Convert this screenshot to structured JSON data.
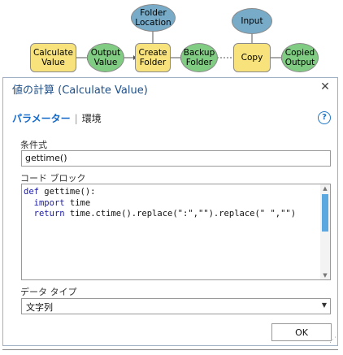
{
  "model": {
    "nodes": {
      "calculate_value": "Calculate\nValue",
      "output_value": "Output\nValue",
      "create_folder": "Create\nFolder",
      "backup_folder": "Backup\nFolder",
      "copy": "Copy",
      "copied_output": "Copied\nOutput",
      "folder_location": "Folder\nLocation",
      "input": "Input"
    },
    "colors": {
      "tool": "#f8e27c",
      "derived_data": "#80cc82",
      "input_data": "#77abc8"
    }
  },
  "dialog": {
    "title": "値の計算 (Calculate Value)",
    "close_icon": "close-icon",
    "tabs": {
      "parameters": "パラメーター",
      "separator": "|",
      "environments": "環境"
    },
    "help_glyph": "?",
    "expression_label": "条件式",
    "expression_value": "gettime()",
    "code_block_label": "コード ブロック",
    "code_block": {
      "line1_kw": "def",
      "line1_rest": " gettime():",
      "line2_indent": "  ",
      "line2_kw": "import",
      "line2_rest": " time",
      "line3_indent": "  ",
      "line3_kw": "return",
      "line3_rest": " time.ctime().replace(\":\",\"\").replace(\" \",\"\")"
    },
    "data_type_label": "データ タイプ",
    "data_type_value": "文字列",
    "ok_label": "OK"
  }
}
